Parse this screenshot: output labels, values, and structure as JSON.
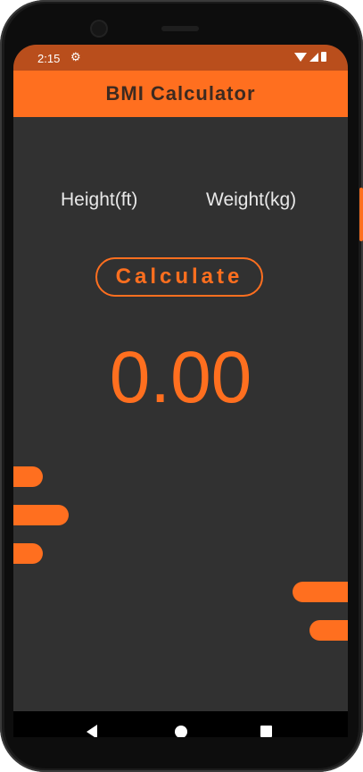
{
  "status_bar": {
    "time": "2:15",
    "settings_icon": "gear-icon",
    "icons": [
      "wifi-icon",
      "signal-icon",
      "battery-icon"
    ]
  },
  "app_bar": {
    "title": "BMI Calculator"
  },
  "labels": {
    "height": "Height(ft)",
    "weight": "Weight(kg)"
  },
  "calculate_button": {
    "label": "Calculate"
  },
  "result": {
    "bmi": "0.00"
  },
  "nav": {
    "icons": [
      "back-icon",
      "home-icon",
      "recents-icon"
    ]
  },
  "colors": {
    "accent": "#ff6f1f",
    "background": "#313131",
    "status_bar": "#b94e1c",
    "title_text": "#3d2a20"
  }
}
